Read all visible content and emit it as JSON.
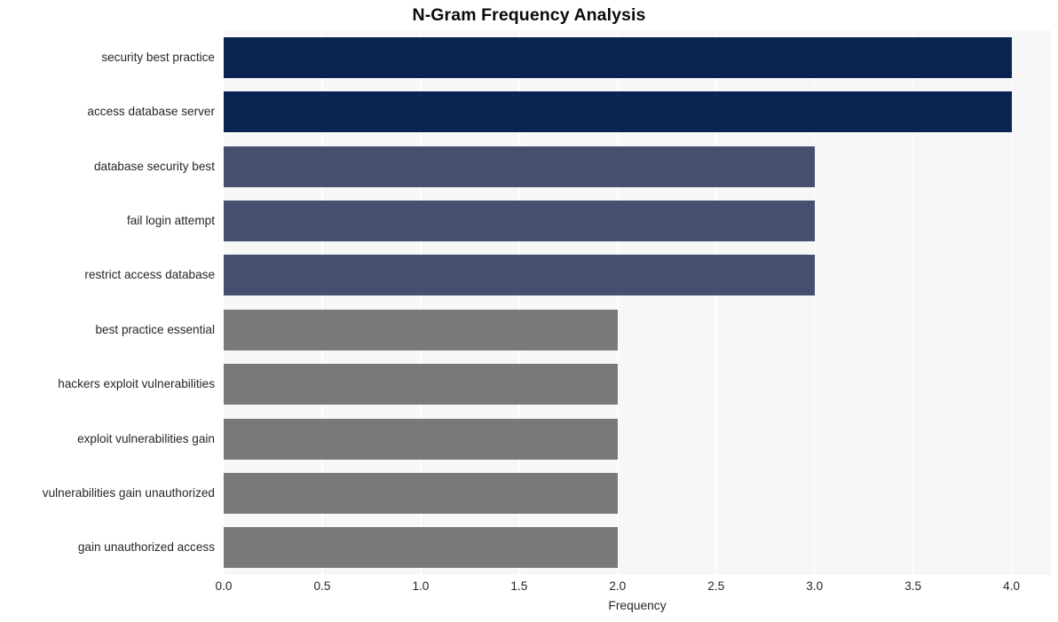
{
  "chart_data": {
    "type": "bar",
    "orientation": "horizontal",
    "title": "N-Gram Frequency Analysis",
    "xlabel": "Frequency",
    "ylabel": "",
    "xlim": [
      0,
      4.2
    ],
    "xticks": [
      "0.0",
      "0.5",
      "1.0",
      "1.5",
      "2.0",
      "2.5",
      "3.0",
      "3.5",
      "4.0"
    ],
    "xtick_values": [
      0,
      0.5,
      1,
      1.5,
      2,
      2.5,
      3,
      3.5,
      4
    ],
    "grid": "vertical-white",
    "legend": "none",
    "categories": [
      "security best practice",
      "access database server",
      "database security best",
      "fail login attempt",
      "restrict access database",
      "best practice essential",
      "hackers exploit vulnerabilities",
      "exploit vulnerabilities gain",
      "vulnerabilities gain unauthorized",
      "gain unauthorized access"
    ],
    "values": [
      4,
      4,
      3,
      3,
      3,
      2,
      2,
      2,
      2,
      2
    ],
    "bar_colors": [
      "#0a2350",
      "#0a2350",
      "#454f6e",
      "#454f6e",
      "#454f6e",
      "#7b7977",
      "#7b7977",
      "#7b7977",
      "#7b7977",
      "#7b7977"
    ]
  },
  "style": {
    "plot_background": "#f7f7f8",
    "figure_background": "#ffffff",
    "gridline_color": "#ffffff",
    "text_color": "#262626",
    "title_color": "#0b0b0b"
  }
}
